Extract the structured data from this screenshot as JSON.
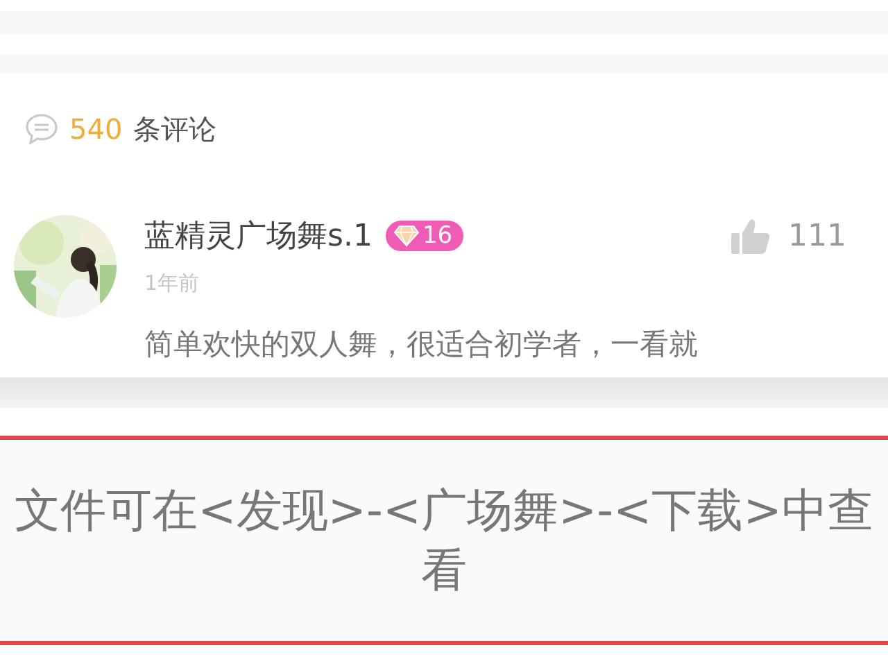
{
  "comments_header": {
    "count": "540",
    "label": "条评论"
  },
  "comments": [
    {
      "author": "蓝精灵广场舞s.1",
      "badge": "16",
      "time": "1年前",
      "likes": "111",
      "text": "简单欢快的双人舞，很适合初学者，一看就"
    }
  ],
  "toast": {
    "message": "文件可在<发现>-<广场舞>-<下载>中查看"
  }
}
